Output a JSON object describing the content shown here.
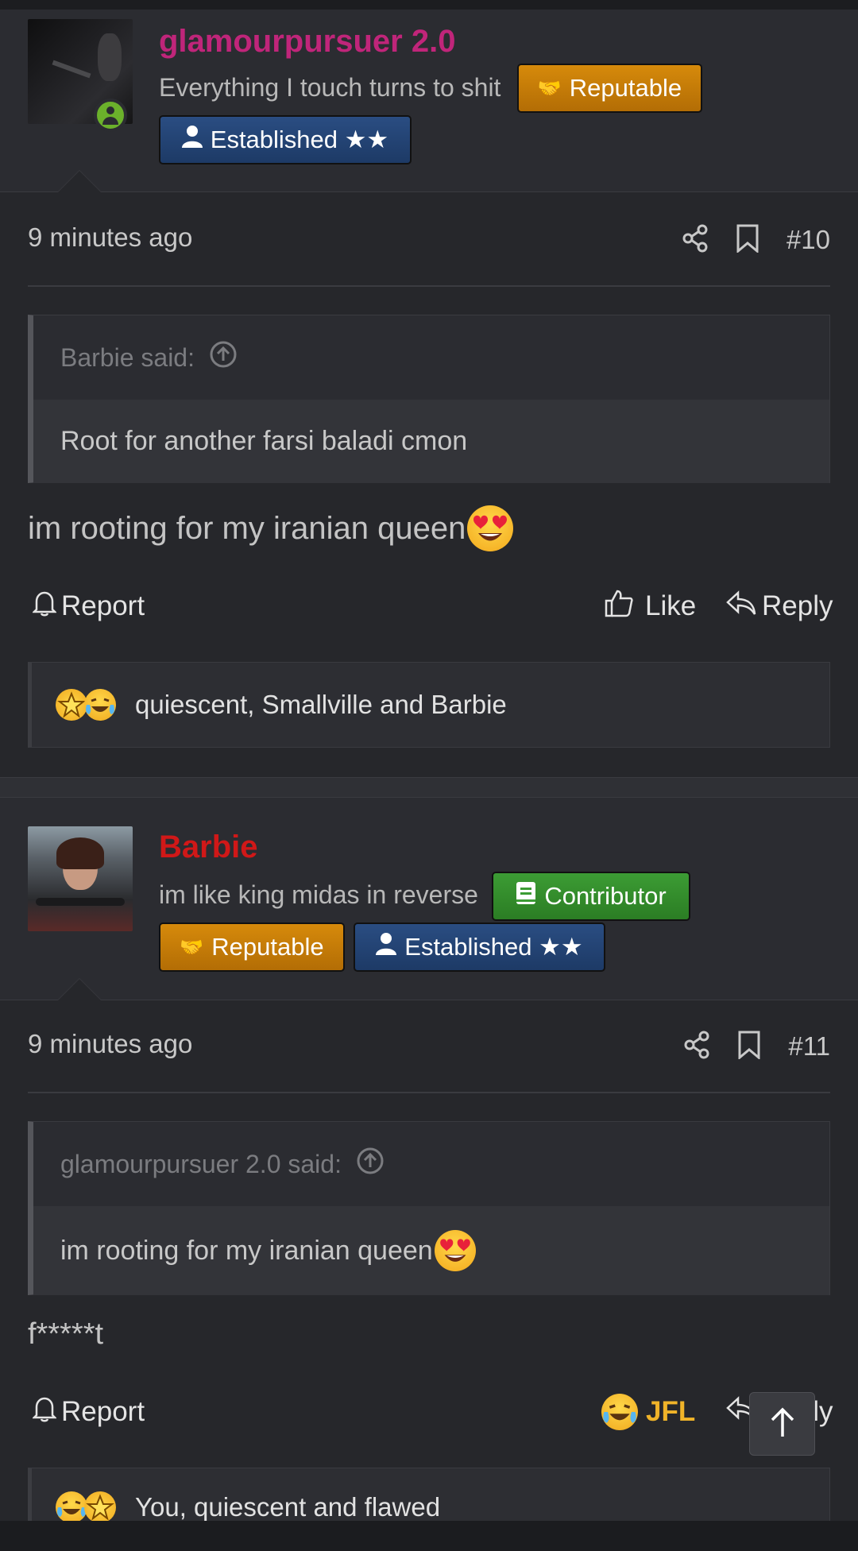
{
  "posts": [
    {
      "username": "glamourpursuer 2.0",
      "username_color": "#c0257a",
      "user_title": "Everything I touch turns to shit",
      "badges": [
        "Reputable",
        "Established ★★"
      ],
      "timestamp": "9 minutes ago",
      "post_number": "#10",
      "quote_author": "Barbie said:",
      "quote_text": "Root for another farsi baladi cmon",
      "message": "im rooting for my iranian queen",
      "actions": {
        "report": "Report",
        "like": "Like",
        "reply": "Reply"
      },
      "reactions_names": "quiescent, Smallville and Barbie"
    },
    {
      "username": "Barbie",
      "username_color": "#d01818",
      "user_title": "im like king midas in reverse",
      "badges": [
        "Contributor",
        "Reputable",
        "Established ★★"
      ],
      "timestamp": "9 minutes ago",
      "post_number": "#11",
      "quote_author": "glamourpursuer 2.0 said:",
      "quote_text": "im rooting for my iranian queen",
      "message": "f*****t",
      "actions": {
        "report": "Report",
        "reaction": "JFL",
        "reply": "Reply"
      },
      "reactions_names": "You, quiescent and flawed"
    }
  ],
  "colors": {
    "reputable": "#d68a0b",
    "established": "#2a4d82",
    "contributor": "#3c9c34",
    "jfl": "#f0b429"
  }
}
